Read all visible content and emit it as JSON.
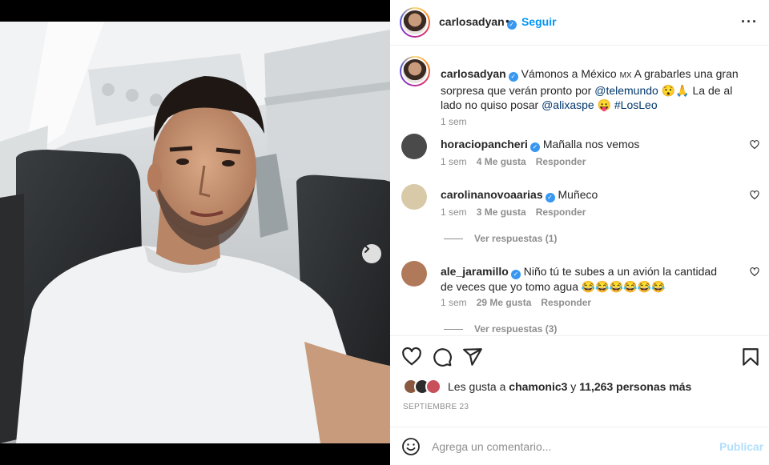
{
  "post": {
    "author": "carlosadyan",
    "follow_label": "Seguir",
    "separator": "•",
    "more_label": "···",
    "carousel": {
      "slides": 2,
      "active_index": 0
    }
  },
  "caption": {
    "username": "carlosadyan",
    "parts": {
      "p1": "Vámonos a México ",
      "flag": "MX",
      "p2": " A grabarles una gran sorpresa que verán pronto por ",
      "mention1": "@telemundo",
      "emoji1": "😯🙏",
      "p3": " La de al lado no quiso posar ",
      "mention2": "@alixaspe",
      "emoji2": "😛",
      "hashtag": "#LosLeo"
    },
    "time": "1 sem"
  },
  "comments": [
    {
      "username": "horaciopancheri",
      "text": "Mañalla nos vemos",
      "time": "1 sem",
      "likes": "4 Me gusta",
      "reply": "Responder",
      "avatar_color": "#555"
    },
    {
      "username": "carolinanovoaarias",
      "text": "Muñeco",
      "time": "1 sem",
      "likes": "3 Me gusta",
      "reply": "Responder",
      "view_replies": "Ver respuestas (1)",
      "avatar_color": "#d8c9a8"
    },
    {
      "username": "ale_jaramillo",
      "text": "Niño tú te subes a un avión la cantidad de veces que yo tomo agua 😂😂😂😂😂😂",
      "time": "1 sem",
      "likes": "29 Me gusta",
      "reply": "Responder",
      "view_replies": "Ver respuestas (3)",
      "avatar_color": "#b07a5a"
    }
  ],
  "likes": {
    "prefix": "Les gusta a ",
    "user": "chamonic3",
    "middle": " y ",
    "count": "11,263 personas más"
  },
  "date": "SEPTIEMBRE 23",
  "add_comment": {
    "placeholder": "Agrega un comentario...",
    "publish_label": "Publicar"
  },
  "icons": [
    "heart-icon",
    "comment-icon",
    "share-icon",
    "bookmark-icon",
    "emoji-icon",
    "chevron-right-icon",
    "more-icon",
    "verified-icon"
  ],
  "colors": {
    "accent": "#0095f6",
    "publish_disabled": "#b2dffc",
    "muted": "#8e8e8e",
    "verified": "#3897f0",
    "link": "#00376b"
  }
}
